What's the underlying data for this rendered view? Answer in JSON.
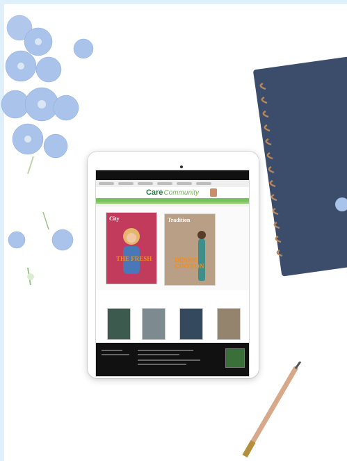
{
  "scene": "styled flat-lay desk with tablet showing a magazine website",
  "website": {
    "logo": {
      "part1": "Care",
      "part2": "Community"
    },
    "cover_left": {
      "headline": "City",
      "name": "THE FRESH"
    },
    "cover_right": {
      "headline": "Tradition",
      "name_line1": "DENISE",
      "name_line2": "CINTRON"
    }
  },
  "colors": {
    "brand_green": "#72c45a",
    "logo_dark_green": "#1e7a3a",
    "notebook_blue": "#3b4d6a",
    "flower_blue": "#a9c3ea"
  }
}
